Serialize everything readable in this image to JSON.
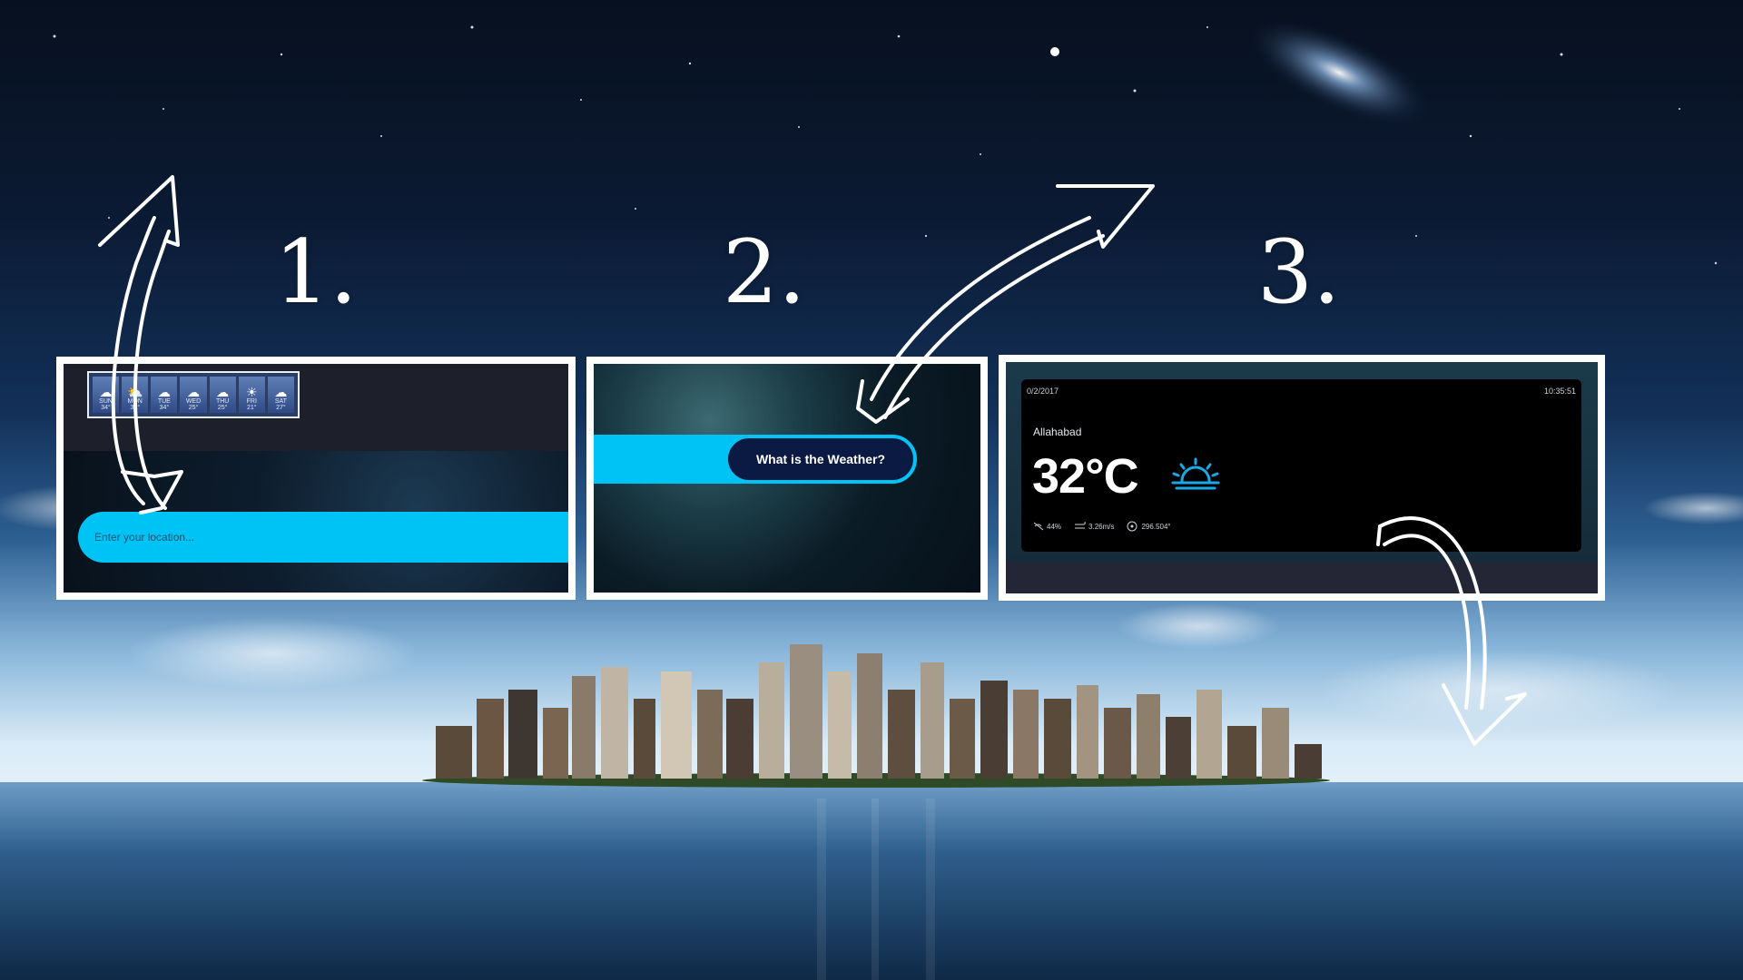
{
  "steps": {
    "step1": "1.",
    "step2": "2.",
    "step3": "3."
  },
  "panel1": {
    "forecast": [
      {
        "day": "SUN",
        "temp": "34°",
        "icon": "cloud-rain-icon"
      },
      {
        "day": "MON",
        "temp": "33°",
        "icon": "sun-cloud-icon"
      },
      {
        "day": "TUE",
        "temp": "34°",
        "icon": "cloud-rain-icon"
      },
      {
        "day": "WED",
        "temp": "25°",
        "icon": "cloud-rain-icon"
      },
      {
        "day": "THU",
        "temp": "25°",
        "icon": "cloud-rain-icon"
      },
      {
        "day": "FRI",
        "temp": "21°",
        "icon": "sun-icon"
      },
      {
        "day": "SAT",
        "temp": "27°",
        "icon": "cloud-rain-icon"
      }
    ],
    "location_placeholder": "Enter your location..."
  },
  "panel2": {
    "button_label": "What is the Weather?"
  },
  "panel3": {
    "date": "0/2/2017",
    "time": "10:35:51",
    "city": "Allahabad",
    "temperature": "32°C",
    "humidity": "44%",
    "wind": "3.26m/s",
    "direction": "296.504°"
  },
  "colors": {
    "accent": "#00c3f5",
    "button_bg": "#0a1a42",
    "card_bg": "#000000"
  }
}
